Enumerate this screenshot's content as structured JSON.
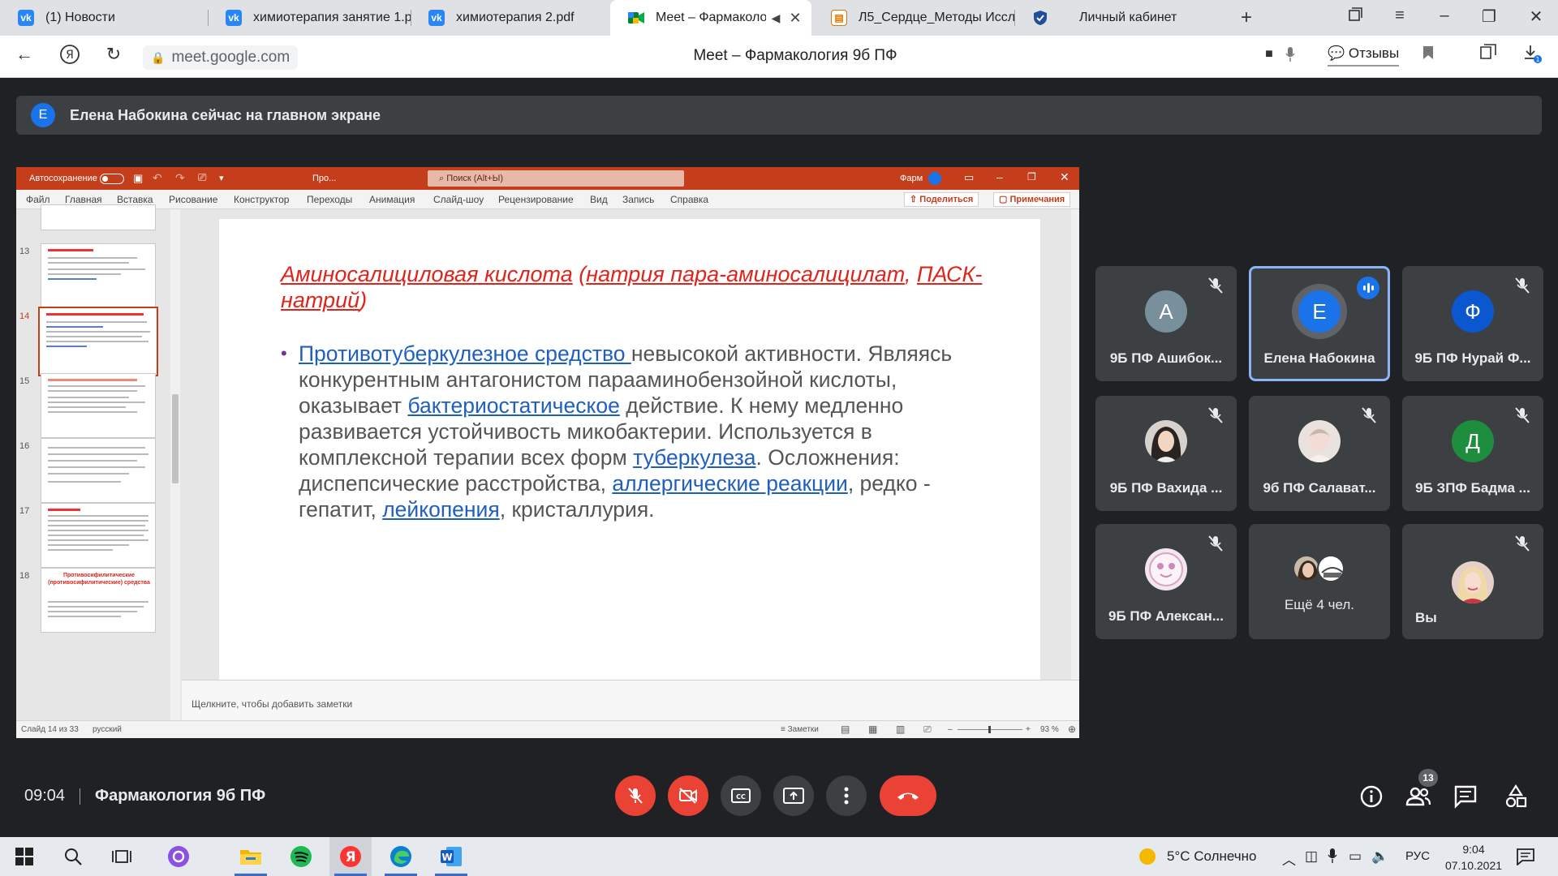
{
  "browser": {
    "tabs": [
      {
        "title": "(1) Новости",
        "icon": "vk-icon"
      },
      {
        "title": "химиотерапия занятие 1.p",
        "icon": "vk-icon"
      },
      {
        "title": "химиотерапия 2.pdf",
        "icon": "vk-icon"
      },
      {
        "title": "Meet – Фармакологи",
        "icon": "meet-icon",
        "active": true
      },
      {
        "title": "Л5_Сердце_Методы Иссле",
        "icon": "pdf-icon"
      },
      {
        "title": "Личный кабинет",
        "icon": "shield-icon"
      }
    ],
    "url": "meet.google.com",
    "page_title": "Meet – Фармакология 9б ПФ",
    "feedback_label": "Отзывы"
  },
  "meet": {
    "banner": {
      "avatar_letter": "Е",
      "text": "Елена Набокина сейчас на главном экране"
    },
    "time": "09:04",
    "meeting_name": "Фармакология 9б ПФ",
    "participants_count": "13",
    "accent": "#1a73e8",
    "danger": "#ea4335"
  },
  "ppt": {
    "autosave": "Автосохранение",
    "doc_name": "Про...",
    "search_placeholder": "Поиск (Alt+Ы)",
    "user": "Фарм",
    "menu": [
      "Файл",
      "Главная",
      "Вставка",
      "Рисование",
      "Конструктор",
      "Переходы",
      "Анимация",
      "Слайд-шоу",
      "Рецензирование",
      "Вид",
      "Запись",
      "Справка"
    ],
    "share": "Поделиться",
    "comments": "Примечания",
    "thumb_numbers": [
      "13",
      "14",
      "15",
      "16",
      "17",
      "18"
    ],
    "thumb18_title": "Противосифилитические (противосифилитические) средства",
    "notes_placeholder": "Щелкните, чтобы добавить заметки",
    "status_slide": "Слайд 14 из 33",
    "status_lang": "русский",
    "status_notes": "Заметки",
    "zoom": "93 %",
    "brand_color": "#c43e1c"
  },
  "slide": {
    "title_a": "Аминосалициловая кислота",
    "title_b": " (",
    "title_c": "натрия пара-аминосалицилат",
    "title_d": ", ",
    "title_e": "ПАСК-натрий",
    "title_f": ")",
    "b1_link": "Противотуберкулезное средство ",
    "b1_text": "невысокой активности. Являясь конкурентным антагонистом парааминобензойной кислоты, оказывает ",
    "b2_link": "бактериостатическое",
    "b2_text": " действие. К нему медленно развивается устойчивость микобактерии. Используется в комплексной терапии всех форм ",
    "b3_link": "туберкулеза",
    "b3_text": ". Осложнения: диспепсические расстройства, ",
    "b4_link": "аллергические реакции",
    "b4_text": ", редко - гепатит, ",
    "b5_link": "лейкопения",
    "b5_text": ", кристаллурия."
  },
  "participants": [
    {
      "name": "9Б ПФ Ашибок...",
      "letter": "А",
      "color": "#78909c",
      "muted": true
    },
    {
      "name": "Елена Набокина",
      "letter": "Е",
      "color": "#1a73e8",
      "speaking": true
    },
    {
      "name": "9Б ПФ Нурай Ф...",
      "letter": "Ф",
      "color": "#0b57d0",
      "muted": true
    },
    {
      "name": "9Б ПФ Вахида ...",
      "photo": true,
      "muted": true
    },
    {
      "name": "9б ПФ Салават...",
      "photo": true,
      "muted": true
    },
    {
      "name": "9Б ЗПФ Бадма ...",
      "letter": "Д",
      "color": "#1e8e3e",
      "muted": true
    },
    {
      "name": "9Б ПФ Алексан...",
      "photo": true,
      "muted": true
    },
    {
      "name": "Ещё 4 чел.",
      "group": true
    },
    {
      "name": "Вы",
      "photo": true,
      "muted": true
    }
  ],
  "taskbar": {
    "weather": "5°C  Солнечно",
    "lang": "РУС",
    "time": "9:04",
    "date": "07.10.2021"
  }
}
